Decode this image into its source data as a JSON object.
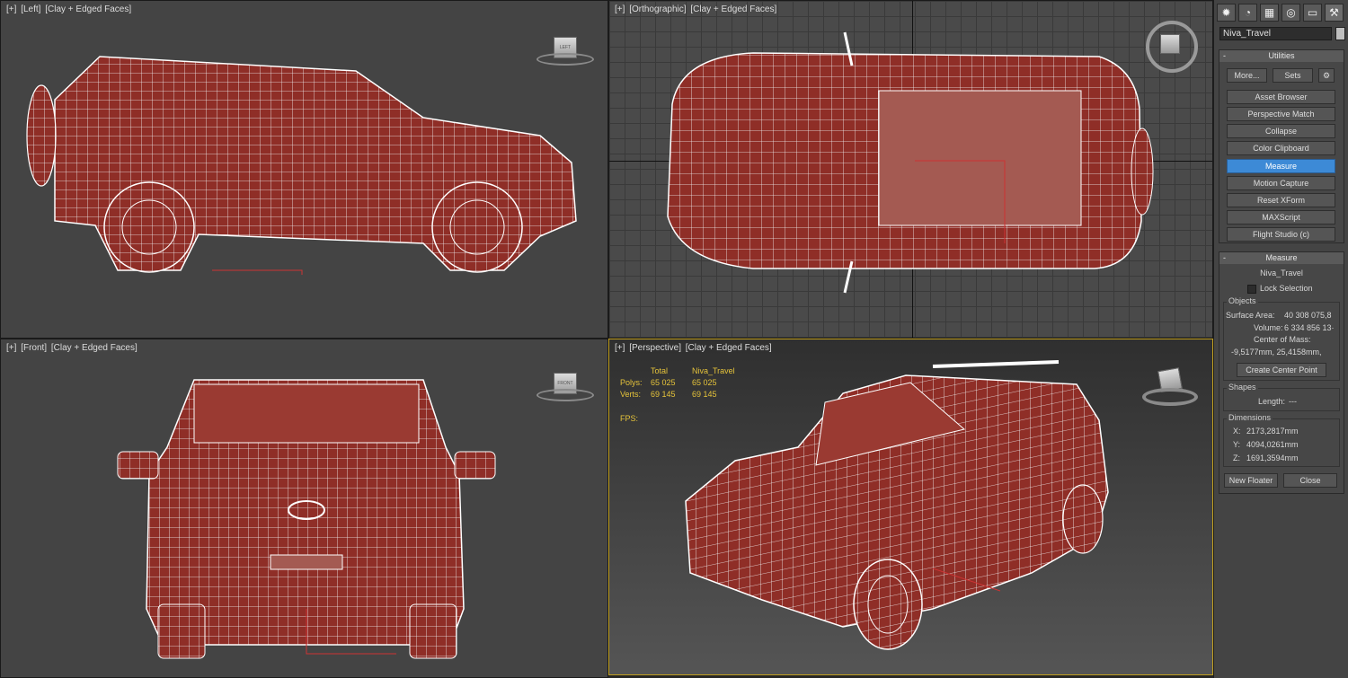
{
  "viewports": {
    "left": {
      "plus": "[+]",
      "view": "[Left]",
      "shading": "[Clay + Edged Faces]",
      "cube_label": "LEFT"
    },
    "top": {
      "plus": "[+]",
      "view": "[Orthographic]",
      "shading": "[Clay + Edged Faces]"
    },
    "front": {
      "plus": "[+]",
      "view": "[Front]",
      "shading": "[Clay + Edged Faces]",
      "cube_label": "FRONT"
    },
    "perspective": {
      "plus": "[+]",
      "view": "[Perspective]",
      "shading": "[Clay + Edged Faces]",
      "stats": {
        "header_total": "Total",
        "header_object": "Niva_Travel",
        "polys_label": "Polys:",
        "polys_total": "65 025",
        "polys_object": "65 025",
        "verts_label": "Verts:",
        "verts_total": "69 145",
        "verts_object": "69 145",
        "fps_label": "FPS:"
      }
    }
  },
  "panel": {
    "tabs": [
      "create-icon",
      "modify-icon",
      "hierarchy-icon",
      "motion-icon",
      "display-icon",
      "utilities-icon"
    ],
    "object_name": "Niva_Travel",
    "utilities": {
      "title": "Utilities",
      "more_label": "More...",
      "sets_label": "Sets",
      "items": [
        "Asset Browser",
        "Perspective Match",
        "Collapse",
        "Color Clipboard",
        "Measure",
        "Motion Capture",
        "Reset XForm",
        "MAXScript",
        "Flight Studio (c)"
      ],
      "selected": "Measure"
    },
    "measure": {
      "title": "Measure",
      "object_name": "Niva_Travel",
      "lock_selection": "Lock Selection",
      "objects_title": "Objects",
      "surface_area_label": "Surface Area:",
      "surface_area": "40 308 075,8",
      "volume_label": "Volume:",
      "volume": "6 334 856 13·",
      "center_of_mass_label": "Center of Mass:",
      "center_of_mass": "-9,5177mm, 25,4158mm,",
      "create_center_point": "Create Center Point",
      "shapes_title": "Shapes",
      "length_label": "Length:",
      "length": "---",
      "dimensions_title": "Dimensions",
      "x_label": "X:",
      "x": "2173,2817mm",
      "y_label": "Y:",
      "y": "4094,0261mm",
      "z_label": "Z:",
      "z": "1691,3594mm",
      "new_floater": "New Floater",
      "close": "Close"
    }
  },
  "colors": {
    "mesh": "#8a2a24",
    "wire": "#ffffff",
    "selected_button": "#3d8ad6",
    "active_viewport_border": "#c2a020",
    "stats_text": "#e5c33a"
  }
}
